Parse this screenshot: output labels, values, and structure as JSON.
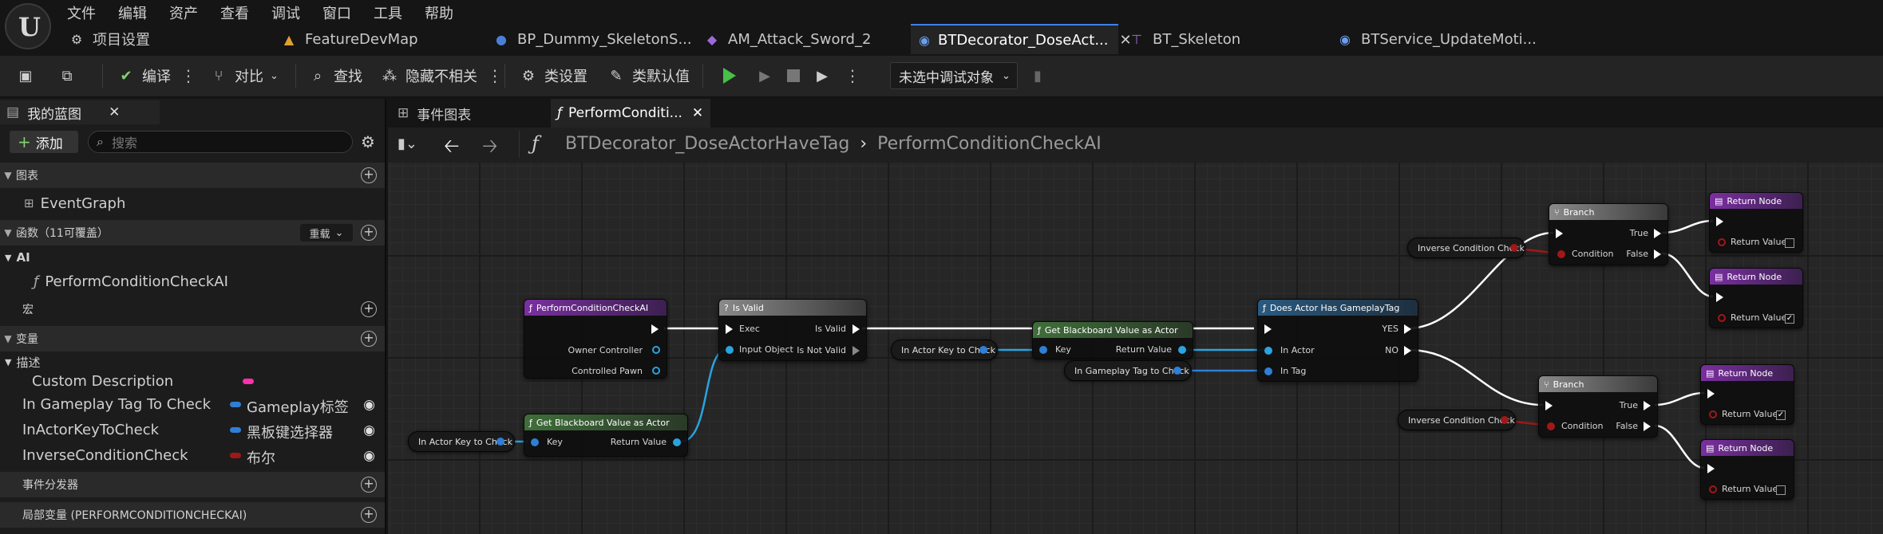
{
  "menu": [
    "文件",
    "编辑",
    "资产",
    "查看",
    "调试",
    "窗口",
    "工具",
    "帮助"
  ],
  "tabs": [
    {
      "label": "项目设置",
      "icon": "gear-icon"
    },
    {
      "label": "FeatureDevMap",
      "icon": "level-icon"
    },
    {
      "label": "BP_Dummy_SkeletonS...",
      "icon": "person-icon"
    },
    {
      "label": "AM_Attack_Sword_2",
      "icon": "montage-icon"
    },
    {
      "label": "BTDecorator_DoseAct...",
      "icon": "decorator-icon",
      "active": true
    },
    {
      "label": "BT_Skeleton",
      "icon": "tree-icon"
    },
    {
      "label": "BTService_UpdateMoti...",
      "icon": "service-icon"
    }
  ],
  "toolbar": {
    "compile": "编译",
    "diff": "对比",
    "find": "查找",
    "hide_unrelated": "隐藏不相关",
    "class_settings": "类设置",
    "class_defaults": "类默认值",
    "debug_target": "未选中调试对象"
  },
  "left_panel": {
    "tab_title": "我的蓝图",
    "add_button": "添加",
    "search_placeholder": "搜索",
    "graphs_header": "图表",
    "event_graph": "EventGraph",
    "functions_header": "函数（11可覆盖）",
    "override_button": "重载",
    "ai_header": "AI",
    "function_item": "PerformConditionCheckAI",
    "macros_header": "宏",
    "variables_header": "变量",
    "description_header": "描述",
    "variables": [
      {
        "name": "Custom Description",
        "type": "",
        "color": "#ff2fb0"
      },
      {
        "name": "In Gameplay Tag To Check",
        "type": "Gameplay标签",
        "color": "#2f7fd6"
      },
      {
        "name": "InActorKeyToCheck",
        "type": "黑板键选择器",
        "color": "#2f7fd6"
      },
      {
        "name": "InverseConditionCheck",
        "type": "布尔",
        "color": "#a01818"
      }
    ],
    "dispatchers_header": "事件分发器",
    "locals_header": "局部变量 (PERFORMCONDITIONCHECKAI)"
  },
  "graph_tabs": [
    {
      "label": "事件图表"
    },
    {
      "label": "PerformConditi..."
    }
  ],
  "breadcrumb": {
    "class": "BTDecorator_DoseActorHaveTag",
    "function": "PerformConditionCheckAI"
  },
  "nodes": {
    "entry": {
      "title": "PerformConditionCheckAI",
      "owner": "Owner Controller",
      "pawn": "Controlled Pawn"
    },
    "is_valid": {
      "title": "Is Valid",
      "exec": "Exec",
      "input": "Input Object",
      "is_valid": "Is Valid",
      "is_not_valid": "Is Not Valid"
    },
    "get_bb_1": {
      "title": "Get Blackboard Value as Actor",
      "key": "Key",
      "ret": "Return Value"
    },
    "get_bb_2": {
      "title": "Get Blackboard Value as Actor",
      "key": "Key",
      "ret": "Return Value"
    },
    "has_tag": {
      "title": "Does Actor Has GameplayTag",
      "in_actor": "In Actor",
      "in_tag": "In Tag",
      "yes": "YES",
      "no": "NO"
    },
    "branch_1": {
      "title": "Branch",
      "cond": "Condition",
      "true": "True",
      "false": "False"
    },
    "branch_2": {
      "title": "Branch",
      "cond": "Condition",
      "true": "True",
      "false": "False"
    },
    "return_1": {
      "title": "Return Node",
      "ret": "Return Value",
      "checked": false
    },
    "return_2": {
      "title": "Return Node",
      "ret": "Return Value",
      "checked": true
    },
    "return_3": {
      "title": "Return Node",
      "ret": "Return Value",
      "checked": true
    },
    "return_4": {
      "title": "Return Node",
      "ret": "Return Value",
      "checked": false
    },
    "var_key_1": "In Actor Key to Check",
    "var_key_2": "In Actor Key to Check",
    "var_tag": "In Gameplay Tag to Check",
    "var_inv_1": "Inverse Condition Check",
    "var_inv_2": "Inverse Condition Check"
  },
  "colors": {
    "accent": "#3b82f6",
    "function_header": "#7a2fa0",
    "pure_header": "#3f6e3a",
    "object_pin": "#2aa3e0",
    "bool_pin": "#a01818",
    "struct_pin": "#2f7fd6"
  }
}
